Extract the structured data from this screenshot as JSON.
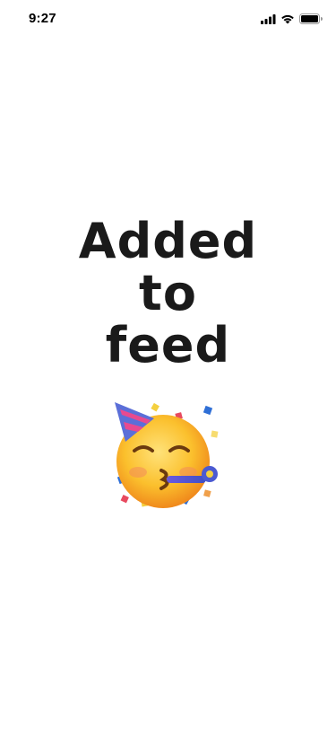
{
  "status_bar": {
    "time": "9:27",
    "signal_icon": "cellular-signal-icon",
    "wifi_icon": "wifi-icon",
    "battery_icon": "battery-icon"
  },
  "main": {
    "headline_lines": [
      "Added",
      "to",
      "feed"
    ],
    "emoji": {
      "icon": "partying-face-emoji",
      "face_color": "#f7b733",
      "hat_color": "#5b6fd8"
    }
  },
  "colors": {
    "background": "#ffffff",
    "text": "#1a1a1a"
  }
}
